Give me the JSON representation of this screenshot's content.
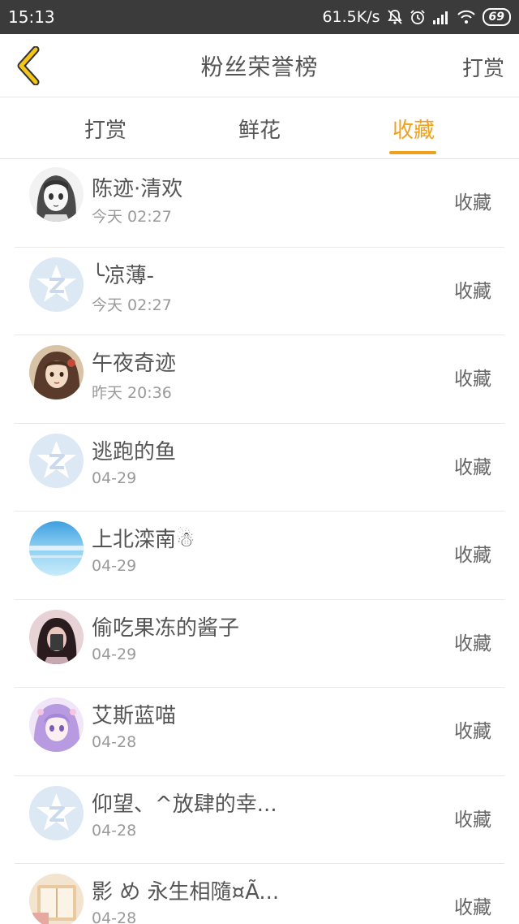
{
  "status": {
    "time": "15:13",
    "speed": "61.5K/s",
    "battery": "69"
  },
  "header": {
    "title": "粉丝荣誉榜",
    "action": "打赏"
  },
  "tabs": [
    {
      "label": "打赏",
      "active": false
    },
    {
      "label": "鲜花",
      "active": false
    },
    {
      "label": "收藏",
      "active": true
    }
  ],
  "list": [
    {
      "name": "陈迹·清欢",
      "date": "今天 02:27",
      "action": "收藏",
      "avatar": "sketch-girl-avatar"
    },
    {
      "name": "╰凉薄-",
      "date": "今天 02:27",
      "action": "收藏",
      "avatar": "default-qq-avatar"
    },
    {
      "name": "午夜奇迹",
      "date": "昨天 20:36",
      "action": "收藏",
      "avatar": "vintage-girl-avatar"
    },
    {
      "name": "逃跑的鱼",
      "date": "04-29",
      "action": "收藏",
      "avatar": "default-qq-avatar"
    },
    {
      "name": "上北滦南☃",
      "date": "04-29",
      "action": "收藏",
      "avatar": "sky-avatar"
    },
    {
      "name": "偷吃果冻的酱子",
      "date": "04-29",
      "action": "收藏",
      "avatar": "selfie-girl-avatar"
    },
    {
      "name": "艾斯蓝喵",
      "date": "04-28",
      "action": "收藏",
      "avatar": "anime-girl-avatar"
    },
    {
      "name": "仰望、^放肆的幸...",
      "date": "04-28",
      "action": "收藏",
      "avatar": "default-qq-avatar"
    },
    {
      "name": "影 め 永生相隨¤Ã...",
      "date": "04-28",
      "action": "收藏",
      "avatar": "book-avatar"
    }
  ]
}
